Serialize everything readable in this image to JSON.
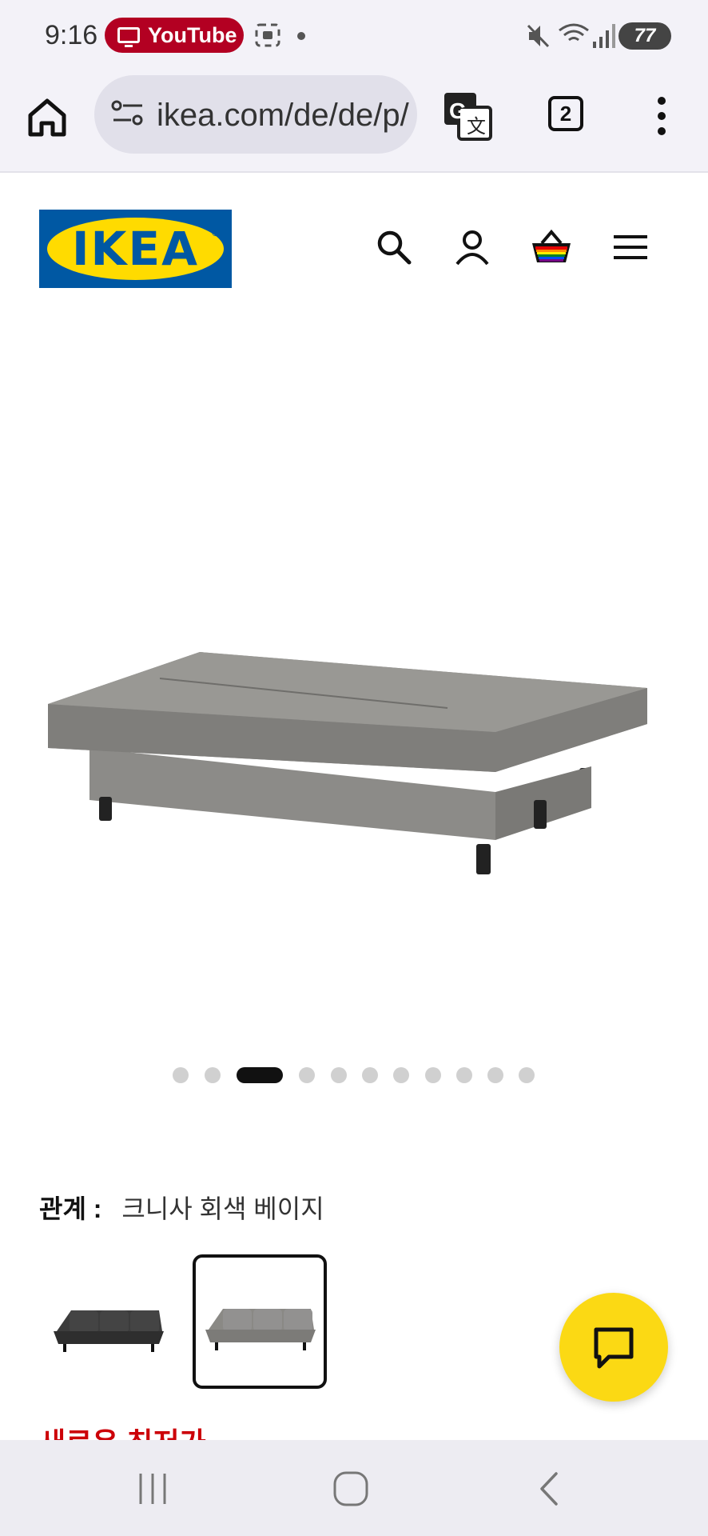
{
  "status_bar": {
    "time": "9:16",
    "notification_pill": "YouTube",
    "battery": "77"
  },
  "browser": {
    "url": "ikea.com/de/de/p/",
    "tab_count": "2"
  },
  "brand": {
    "logo_text": "IKEA",
    "logo_registered": "®"
  },
  "product": {
    "carousel": {
      "total_images": 11,
      "active_index": 2
    },
    "color_label": "관계 :",
    "color_value": "크니사 회색 베이지",
    "swatches": [
      {
        "name": "dark-grey-sofa",
        "selected": false
      },
      {
        "name": "grey-beige-sofa",
        "selected": true
      }
    ],
    "price_heading": "새로운 최저가"
  },
  "colors": {
    "ikea_blue": "#0058a3",
    "ikea_yellow": "#ffdb00",
    "price_red": "#cc0008",
    "youtube_pill": "#b30022",
    "chat_yellow": "#fbd914"
  },
  "icons": [
    "home-icon",
    "site-info-icon",
    "translate-icon",
    "tabs-icon",
    "more-icon",
    "search-icon",
    "profile-icon",
    "basket-icon",
    "hamburger-menu-icon",
    "heart-icon",
    "chat-icon",
    "recents-icon",
    "home-nav-icon",
    "back-icon"
  ]
}
